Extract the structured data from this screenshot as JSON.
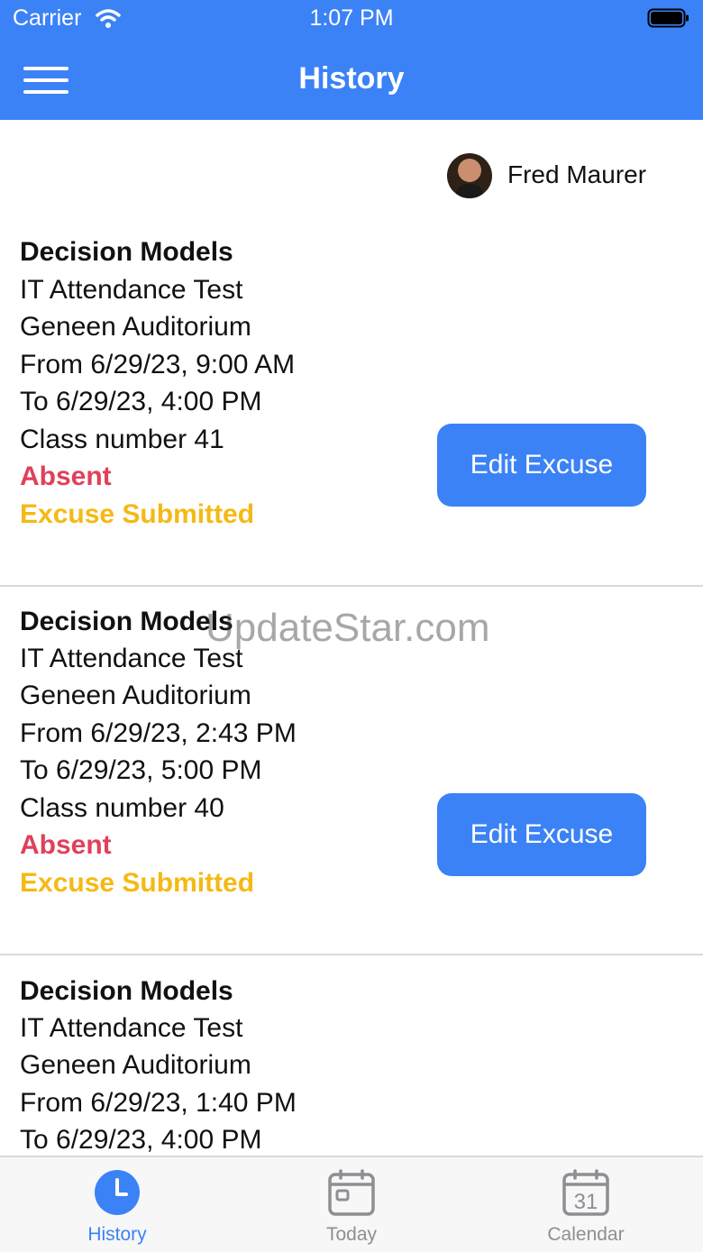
{
  "status_bar": {
    "carrier": "Carrier",
    "time": "1:07 PM"
  },
  "header": {
    "title": "History",
    "bg_color": "#3b82f6"
  },
  "user": {
    "name": "Fred Maurer"
  },
  "records": [
    {
      "course": "Decision Models",
      "event": "IT Attendance Test",
      "location": "Geneen Auditorium",
      "from": "From 6/29/23, 9:00 AM",
      "to": "To 6/29/23, 4:00 PM",
      "class_number": "Class number 41",
      "status": "Absent",
      "excuse_status": "Excuse Submitted",
      "button_label": "Edit Excuse"
    },
    {
      "course": "Decision Models",
      "event": "IT Attendance Test",
      "location": "Geneen Auditorium",
      "from": "From 6/29/23, 2:43 PM",
      "to": "To 6/29/23, 5:00 PM",
      "class_number": "Class number 40",
      "status": "Absent",
      "excuse_status": "Excuse Submitted",
      "button_label": "Edit Excuse"
    },
    {
      "course": "Decision Models",
      "event": "IT Attendance Test",
      "location": "Geneen Auditorium",
      "from": "From 6/29/23, 1:40 PM",
      "to": "To 6/29/23, 4:00 PM"
    }
  ],
  "watermark": "UpdateStar.com",
  "tab_bar": {
    "tabs": [
      {
        "label": "History",
        "icon": "clock-icon",
        "active": true
      },
      {
        "label": "Today",
        "icon": "calendar-day-icon",
        "active": false
      },
      {
        "label": "Calendar",
        "icon": "calendar-31-icon",
        "active": false
      }
    ],
    "active_color": "#3b82f6",
    "inactive_color": "#8e8e93"
  },
  "colors": {
    "absent": "#e0405a",
    "excuse_submitted": "#f5b914",
    "button": "#3b82f6"
  }
}
